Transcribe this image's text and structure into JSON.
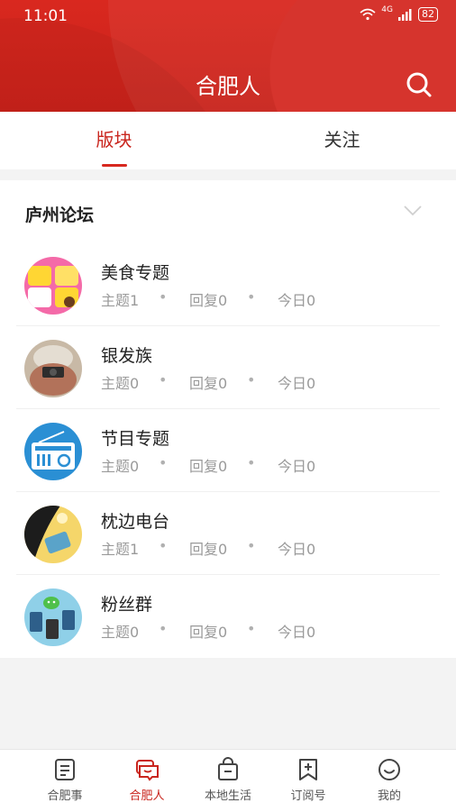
{
  "status_bar": {
    "time": "11:01",
    "network": "4G",
    "battery": "82"
  },
  "header": {
    "title": "合肥人"
  },
  "tabs": [
    {
      "label": "版块",
      "active": true
    },
    {
      "label": "关注",
      "active": false
    }
  ],
  "section": {
    "title": "庐州论坛"
  },
  "forums": [
    {
      "name": "美食专题",
      "topics": "主题1",
      "replies": "回复0",
      "today": "今日0",
      "avatar_icon": "food-avatar-icon"
    },
    {
      "name": "银发族",
      "topics": "主题0",
      "replies": "回复0",
      "today": "今日0",
      "avatar_icon": "elderly-avatar-icon"
    },
    {
      "name": "节目专题",
      "topics": "主题0",
      "replies": "回复0",
      "today": "今日0",
      "avatar_icon": "radio-avatar-icon"
    },
    {
      "name": "枕边电台",
      "topics": "主题1",
      "replies": "回复0",
      "today": "今日0",
      "avatar_icon": "bedside-radio-avatar-icon"
    },
    {
      "name": "粉丝群",
      "topics": "主题0",
      "replies": "回复0",
      "today": "今日0",
      "avatar_icon": "fans-avatar-icon"
    }
  ],
  "bottom_nav": [
    {
      "label": "合肥事",
      "icon": "news-icon",
      "active": false
    },
    {
      "label": "合肥人",
      "icon": "community-icon",
      "active": true
    },
    {
      "label": "本地生活",
      "icon": "shopping-bag-icon",
      "active": false
    },
    {
      "label": "订阅号",
      "icon": "bookmark-icon",
      "active": false
    },
    {
      "label": "我的",
      "icon": "smile-icon",
      "active": false
    }
  ],
  "colors": {
    "brand_red": "#d7281f",
    "active_text": "#c9251d"
  }
}
